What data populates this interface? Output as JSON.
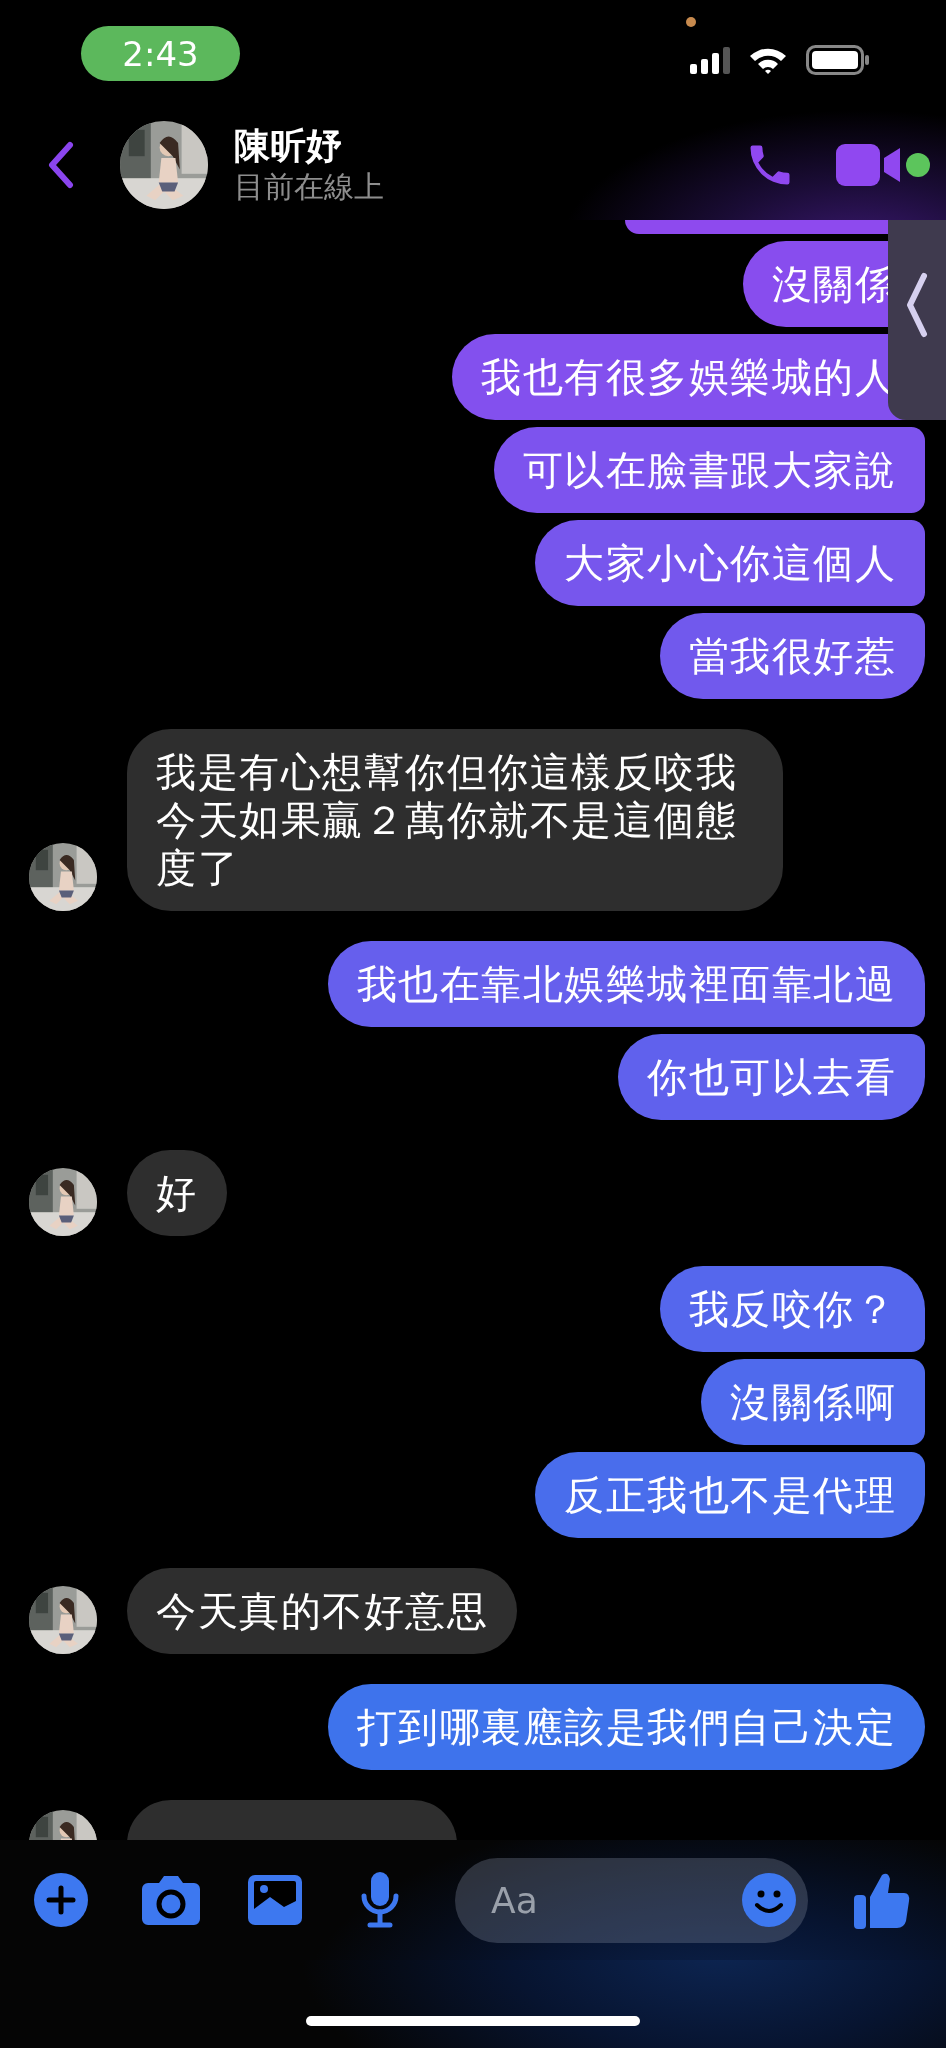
{
  "status_bar": {
    "time": "2:43"
  },
  "header": {
    "name": "陳昕妤",
    "status": "目前在線上"
  },
  "messages": [
    {
      "kind": "sent_partial"
    },
    {
      "kind": "sent",
      "text": "沒關係"
    },
    {
      "kind": "sent",
      "text": "我也有很多娛樂城的人"
    },
    {
      "kind": "sent",
      "text": "可以在臉書跟大家說"
    },
    {
      "kind": "sent",
      "text": "大家小心你這個人"
    },
    {
      "kind": "sent",
      "text": "當我很好惹"
    },
    {
      "kind": "received",
      "text": "我是有心想幫你但你這樣反咬我今天如果贏２萬你就不是這個態度了"
    },
    {
      "kind": "sent",
      "text": "我也在靠北娛樂城裡面靠北過"
    },
    {
      "kind": "sent",
      "text": "你也可以去看"
    },
    {
      "kind": "received",
      "text": "好"
    },
    {
      "kind": "sent",
      "text": "我反咬你？"
    },
    {
      "kind": "sent",
      "text": "沒關係啊"
    },
    {
      "kind": "sent",
      "text": "反正我也不是代理"
    },
    {
      "kind": "received",
      "text": "今天真的不好意思"
    },
    {
      "kind": "sent",
      "text": "打到哪裏應該是我們自己決定"
    },
    {
      "kind": "received_partial"
    }
  ],
  "composer": {
    "placeholder": "Aa"
  }
}
